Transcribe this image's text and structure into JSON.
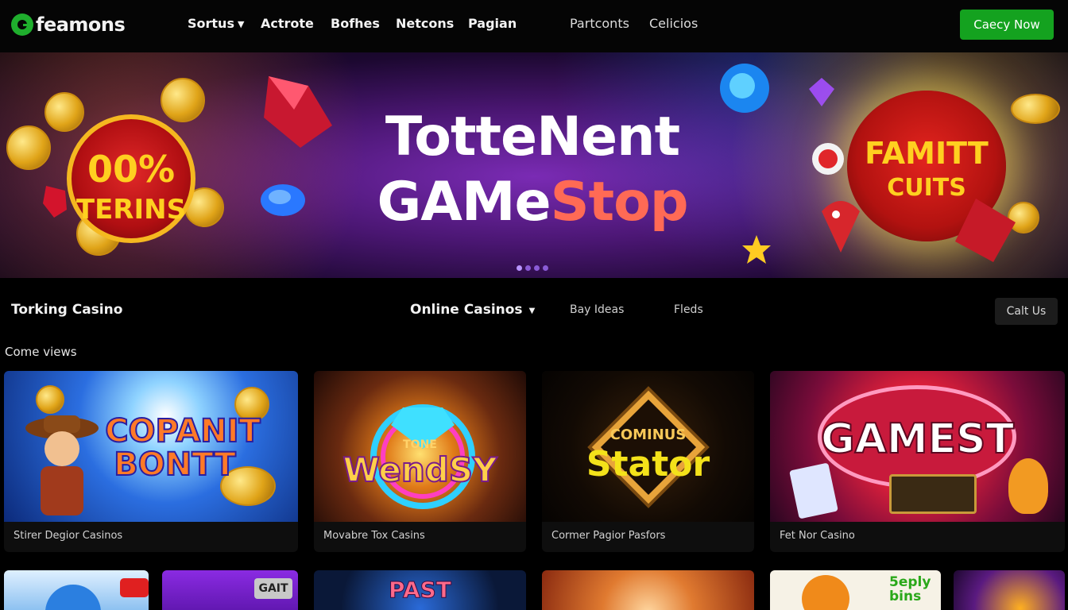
{
  "brand": {
    "name": "feamons",
    "accent": "#14a21f"
  },
  "nav": {
    "items": [
      {
        "label": "Sortus",
        "dropdown": true
      },
      {
        "label": "Actrote"
      },
      {
        "label": "Bofhes"
      },
      {
        "label": "Netcons"
      },
      {
        "label": "Pagian"
      },
      {
        "label": "Partconts"
      },
      {
        "label": "Celicios"
      }
    ],
    "cta_label": "Caecy Now"
  },
  "hero": {
    "title_line1": "TotteNent",
    "title_line2_main": "GAMe",
    "title_line2_accent": "Stop",
    "left_badge_line1": "00%",
    "left_badge_line2": "TERINS",
    "right_badge_line1": "FAMITT",
    "right_badge_line2": "CUITS",
    "slides": 4,
    "active_slide": 1
  },
  "section": {
    "title": "Torking Casino",
    "menu": [
      {
        "label": "Online Casinos",
        "dropdown": true
      },
      {
        "label": "Bay Ideas"
      },
      {
        "label": "Fleds"
      }
    ],
    "call_label": "Calt Us",
    "subtitle": "Come views"
  },
  "cards": [
    {
      "label": "Stirer Degior Casinos",
      "art_line1": "COPANIT",
      "art_line2": "BONTT"
    },
    {
      "label": "Movabre Tox Casins",
      "art_line1": "TONE",
      "art_line2": "WendSY"
    },
    {
      "label": "Cormer Pagior Pasfors",
      "art_line1": "COMINUS",
      "art_line2": "Stator"
    },
    {
      "label": "Fet Nor Casino",
      "art_line1": "GAMEST",
      "art_line2": ""
    }
  ],
  "bottom_tiles": [
    {
      "text": ""
    },
    {
      "text": "GAIT"
    },
    {
      "text": "PAST"
    },
    {
      "text": ""
    },
    {
      "text": "5eply bins"
    },
    {
      "text": ""
    }
  ]
}
